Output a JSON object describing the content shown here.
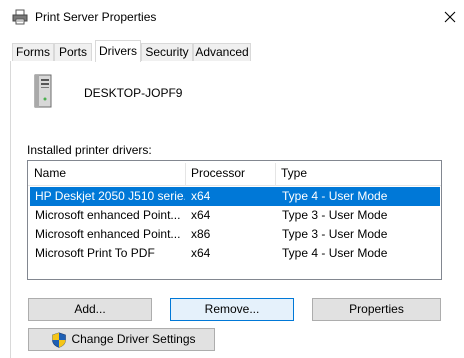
{
  "window": {
    "title": "Print Server Properties",
    "icon": "printer-icon",
    "close_icon": "close-icon"
  },
  "tabs": [
    {
      "label": "Forms"
    },
    {
      "label": "Ports"
    },
    {
      "label": "Drivers"
    },
    {
      "label": "Security"
    },
    {
      "label": "Advanced"
    }
  ],
  "active_tab": "Drivers",
  "server": {
    "name": "DESKTOP-JOPF9",
    "icon": "computer-tower-icon"
  },
  "drivers": {
    "section_label": "Installed printer drivers:",
    "columns": [
      "Name",
      "Processor",
      "Type"
    ],
    "rows": [
      {
        "name": "HP Deskjet 2050 J510 serie...",
        "processor": "x64",
        "type": "Type 4 - User Mode"
      },
      {
        "name": "Microsoft enhanced Point...",
        "processor": "x64",
        "type": "Type 3 - User Mode"
      },
      {
        "name": "Microsoft enhanced Point...",
        "processor": "x86",
        "type": "Type 3 - User Mode"
      },
      {
        "name": "Microsoft Print To PDF",
        "processor": "x64",
        "type": "Type 4 - User Mode"
      }
    ],
    "selected_row": 0
  },
  "buttons": {
    "add": "Add...",
    "remove": "Remove...",
    "properties": "Properties",
    "change_driver_settings": "Change Driver Settings",
    "shield_icon": "uac-shield-icon"
  },
  "colors": {
    "selection": "#0078d7",
    "button_face": "#e1e1e1",
    "focus_border": "#0078d7"
  }
}
